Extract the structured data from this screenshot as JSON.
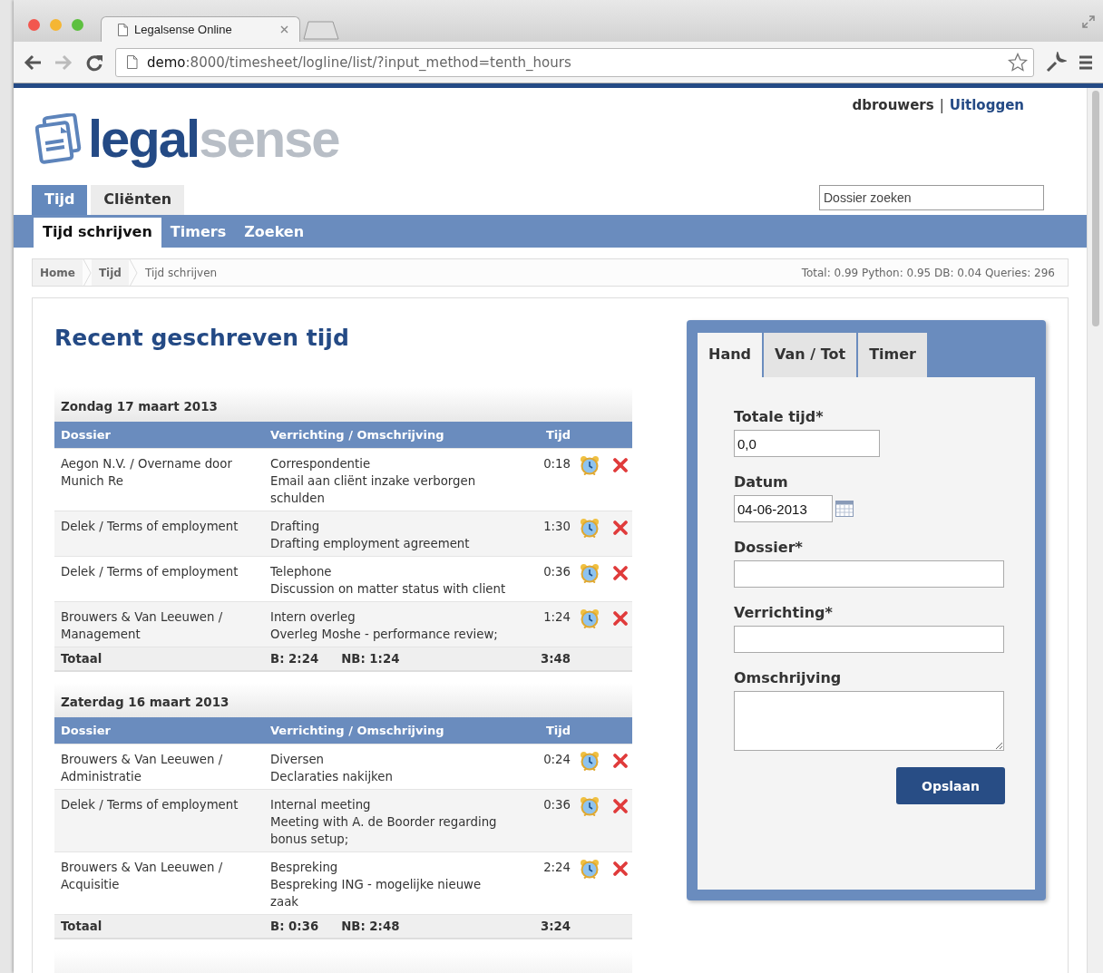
{
  "browser": {
    "tabs": [
      {
        "title": "Legalsense Online",
        "selected": true
      }
    ],
    "url_host": "demo",
    "url_rest": ":8000/timesheet/logline/list/?input_method=tenth_hours"
  },
  "user": {
    "name": "dbrouwers",
    "separator": "|",
    "logout": "Uitloggen"
  },
  "logo": {
    "part1": "legal",
    "part2": "sense"
  },
  "main_tabs": [
    {
      "label": "Tijd",
      "selected": true
    },
    {
      "label": "Cliënten",
      "selected": false
    }
  ],
  "search": {
    "placeholder": "Dossier zoeken"
  },
  "sub_tabs": [
    {
      "label": "Tijd schrijven",
      "selected": true
    },
    {
      "label": "Timers",
      "selected": false
    },
    {
      "label": "Zoeken",
      "selected": false
    }
  ],
  "breadcrumbs": [
    {
      "label": "Home",
      "kind": "link"
    },
    {
      "label": "Tijd",
      "kind": "link"
    },
    {
      "label": "Tijd schrijven",
      "kind": "current"
    }
  ],
  "stats": "Total: 0.99 Python: 0.95 DB: 0.04 Queries: 296",
  "heading": "Recent geschreven tijd",
  "days": [
    {
      "title": "Zondag 17 maart 2013",
      "columns": [
        "Dossier",
        "Verrichting / Omschrijving",
        "Tijd"
      ],
      "rows": [
        {
          "dossier": "Aegon N.V. / Overname door Munich Re",
          "activity": "Correspondentie",
          "description": "Email aan cliënt inzake verborgen schulden",
          "time": "0:18"
        },
        {
          "dossier": "Delek / Terms of employment",
          "activity": "Drafting",
          "description": "Drafting employment agreement",
          "time": "1:30"
        },
        {
          "dossier": "Delek / Terms of employment",
          "activity": "Telephone",
          "description": "Discussion on matter status with client",
          "time": "0:36"
        },
        {
          "dossier": "Brouwers & Van Leeuwen / Management",
          "activity": "Intern overleg",
          "description": "Overleg Moshe - performance review;",
          "time": "1:24"
        }
      ],
      "total": {
        "label": "Totaal",
        "billable": "B: 2:24",
        "non_billable": "NB: 1:24",
        "time": "3:48"
      }
    },
    {
      "title": "Zaterdag 16 maart 2013",
      "columns": [
        "Dossier",
        "Verrichting / Omschrijving",
        "Tijd"
      ],
      "rows": [
        {
          "dossier": "Brouwers & Van Leeuwen / Administratie",
          "activity": "Diversen",
          "description": "Declaraties nakijken",
          "time": "0:24"
        },
        {
          "dossier": "Delek / Terms of employment",
          "activity": "Internal meeting",
          "description": "Meeting with A. de Boorder regarding bonus setup;",
          "time": "0:36"
        },
        {
          "dossier": "Brouwers & Van Leeuwen / Acquisitie",
          "activity": "Bespreking",
          "description": "Bespreking ING - mogelijke nieuwe zaak",
          "time": "2:24"
        }
      ],
      "total": {
        "label": "Totaal",
        "billable": "B: 0:36",
        "non_billable": "NB: 2:48",
        "time": "3:24"
      }
    }
  ],
  "form": {
    "tabs": [
      {
        "label": "Hand",
        "selected": true
      },
      {
        "label": "Van / Tot",
        "selected": false
      },
      {
        "label": "Timer",
        "selected": false
      }
    ],
    "fields": [
      {
        "label": "Totale tijd*",
        "value": "0,0",
        "kind": "short"
      },
      {
        "label": "Datum",
        "value": "04-06-2013",
        "kind": "date"
      },
      {
        "label": "Dossier*",
        "kind": "wide"
      },
      {
        "label": "Verrichting*",
        "kind": "wide"
      },
      {
        "label": "Omschrijving",
        "kind": "textarea"
      }
    ],
    "submit": "Opslaan"
  }
}
